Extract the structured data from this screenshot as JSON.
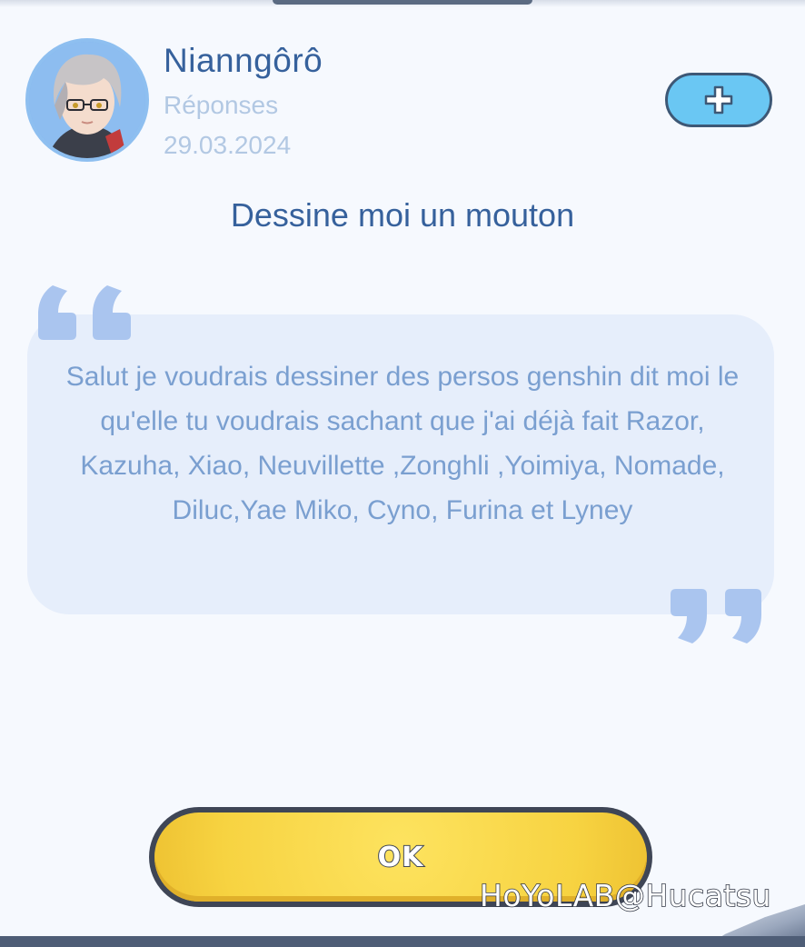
{
  "profile": {
    "username": "Nianngôrô",
    "subtitle": "Réponses",
    "date": "29.03.2024"
  },
  "add_button": {
    "icon": "plus-icon",
    "color": "#6ac7f3"
  },
  "post": {
    "title": "Dessine moi un mouton",
    "message": "Salut je voudrais dessiner des persos genshin dit moi le qu'elle tu voudrais sachant que j'ai déjà fait Razor, Kazuha, Xiao, Neuvillette ,Zonghli ,Yoimiya, Nomade, Diluc,Yae Miko, Cyno, Furina et Lyney"
  },
  "actions": {
    "ok_label": "OK"
  },
  "watermark": "HoYoLAB@Hucatsu",
  "colors": {
    "accent": "#36619c",
    "muted": "#b2c8e3",
    "bubble": "#e6eefb",
    "quote": "#aac5ef",
    "ok_button": "#f7d341"
  }
}
